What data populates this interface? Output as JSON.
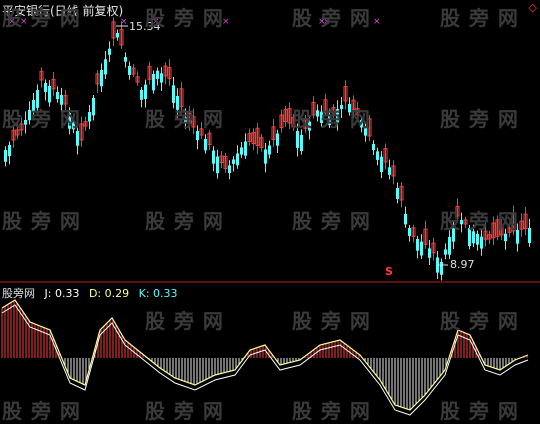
{
  "window": {
    "title": "平安银行(日线 前复权)",
    "corner_icon": "diamond-icon"
  },
  "watermark": "股 旁 网",
  "price_chart": {
    "high_label": "15.34",
    "low_label": "8.97",
    "signal_marker": "S"
  },
  "indicator": {
    "name": "股旁网",
    "j_label": "J: 0.33",
    "d_label": "D: 0.29",
    "k_label": "K: 0.33"
  },
  "colors": {
    "background": "#000000",
    "up_candle": "#ff3a3a",
    "down_candle": "#54ffff",
    "signal_x": "#d64ad6",
    "kdj_line": "#ffff99",
    "separator": "#b02020"
  }
}
